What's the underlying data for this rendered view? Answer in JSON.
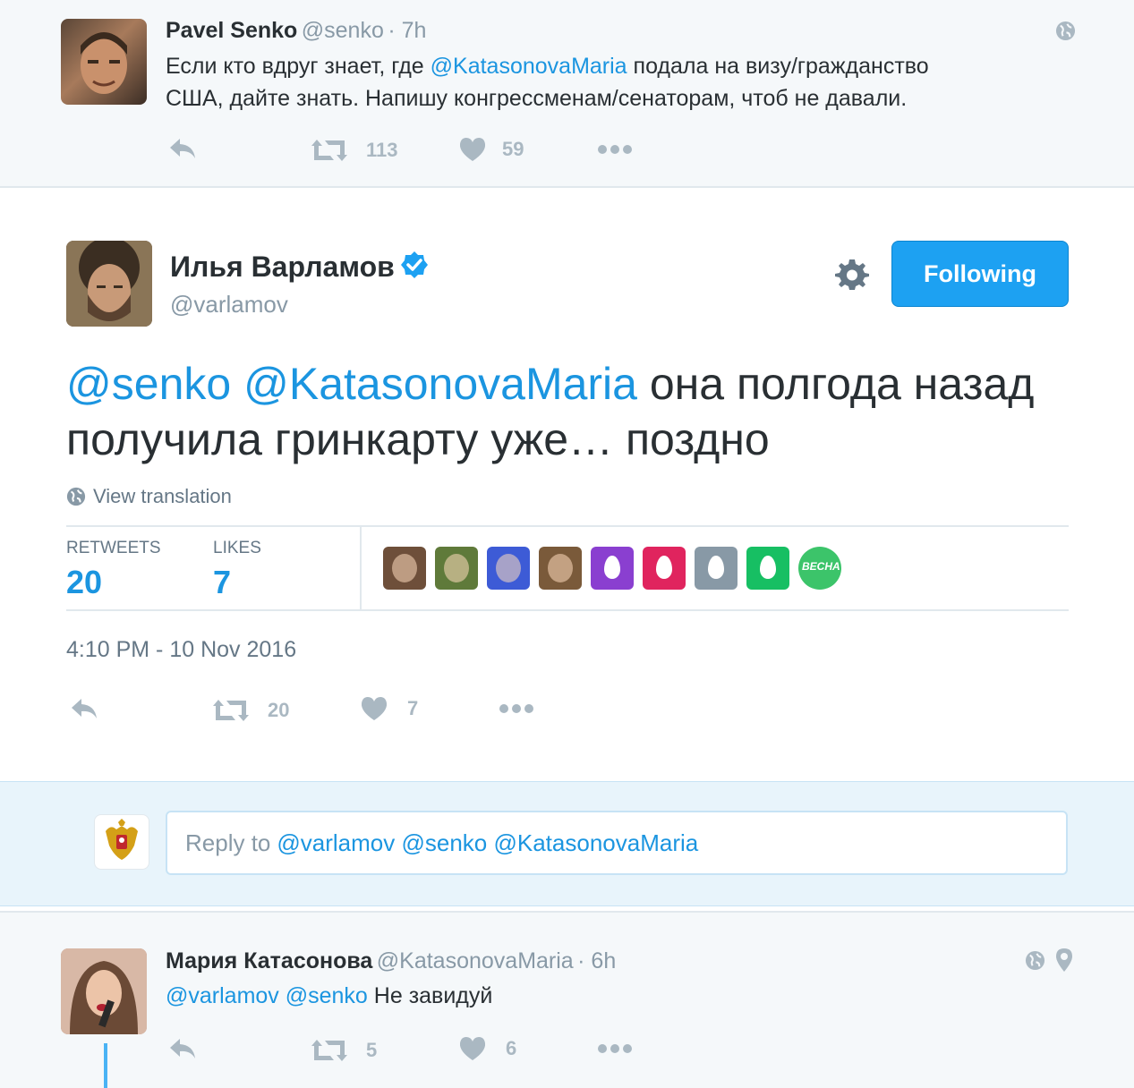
{
  "top_tweet": {
    "name": "Pavel Senko",
    "handle": "@senko",
    "time": "· 7h",
    "text_before": "Если кто вдруг знает, где ",
    "mention": "@KatasonovaMaria",
    "text_after_line1": " подала на визу/гражданство",
    "text_line2": "США, дайте знать. Напишу конгрессменам/сенаторам, чтоб не давали.",
    "retweets": "113",
    "likes": "59"
  },
  "main_tweet": {
    "name": "Илья Варламов",
    "handle": "@varlamov",
    "follow_label": "Following",
    "mention1": "@senko",
    "mention2": "@KatasonovaMaria",
    "text_line1": " она полгода назад",
    "text_line2": "получила гринкарту уже… поздно",
    "view_translation": "View translation",
    "retweets_label": "RETWEETS",
    "retweets_count": "20",
    "likes_label": "LIKES",
    "likes_count": "7",
    "timestamp": "4:10 PM - 10 Nov 2016",
    "action_retweets": "20",
    "action_likes": "7",
    "liker_colors": [
      "#6e4f3a",
      "#5f7a3a",
      "#3d5bd6",
      "#7a5a3a",
      "#8a3fd0",
      "#e0245e",
      "#8899a6",
      "#17bf63",
      "#3cc46a"
    ],
    "liker_badge_text": "ВЕСНА"
  },
  "reply": {
    "placeholder_prefix": "Reply to ",
    "mentions": "@varlamov @senko @KatasonovaMaria"
  },
  "bottom_tweet": {
    "name": "Мария Катасонова",
    "handle": "@KatasonovaMaria",
    "time": "· 6h",
    "mention1": "@varlamov",
    "mention2": "@senko",
    "text": " Не завидуй",
    "retweets": "5",
    "likes": "6"
  }
}
